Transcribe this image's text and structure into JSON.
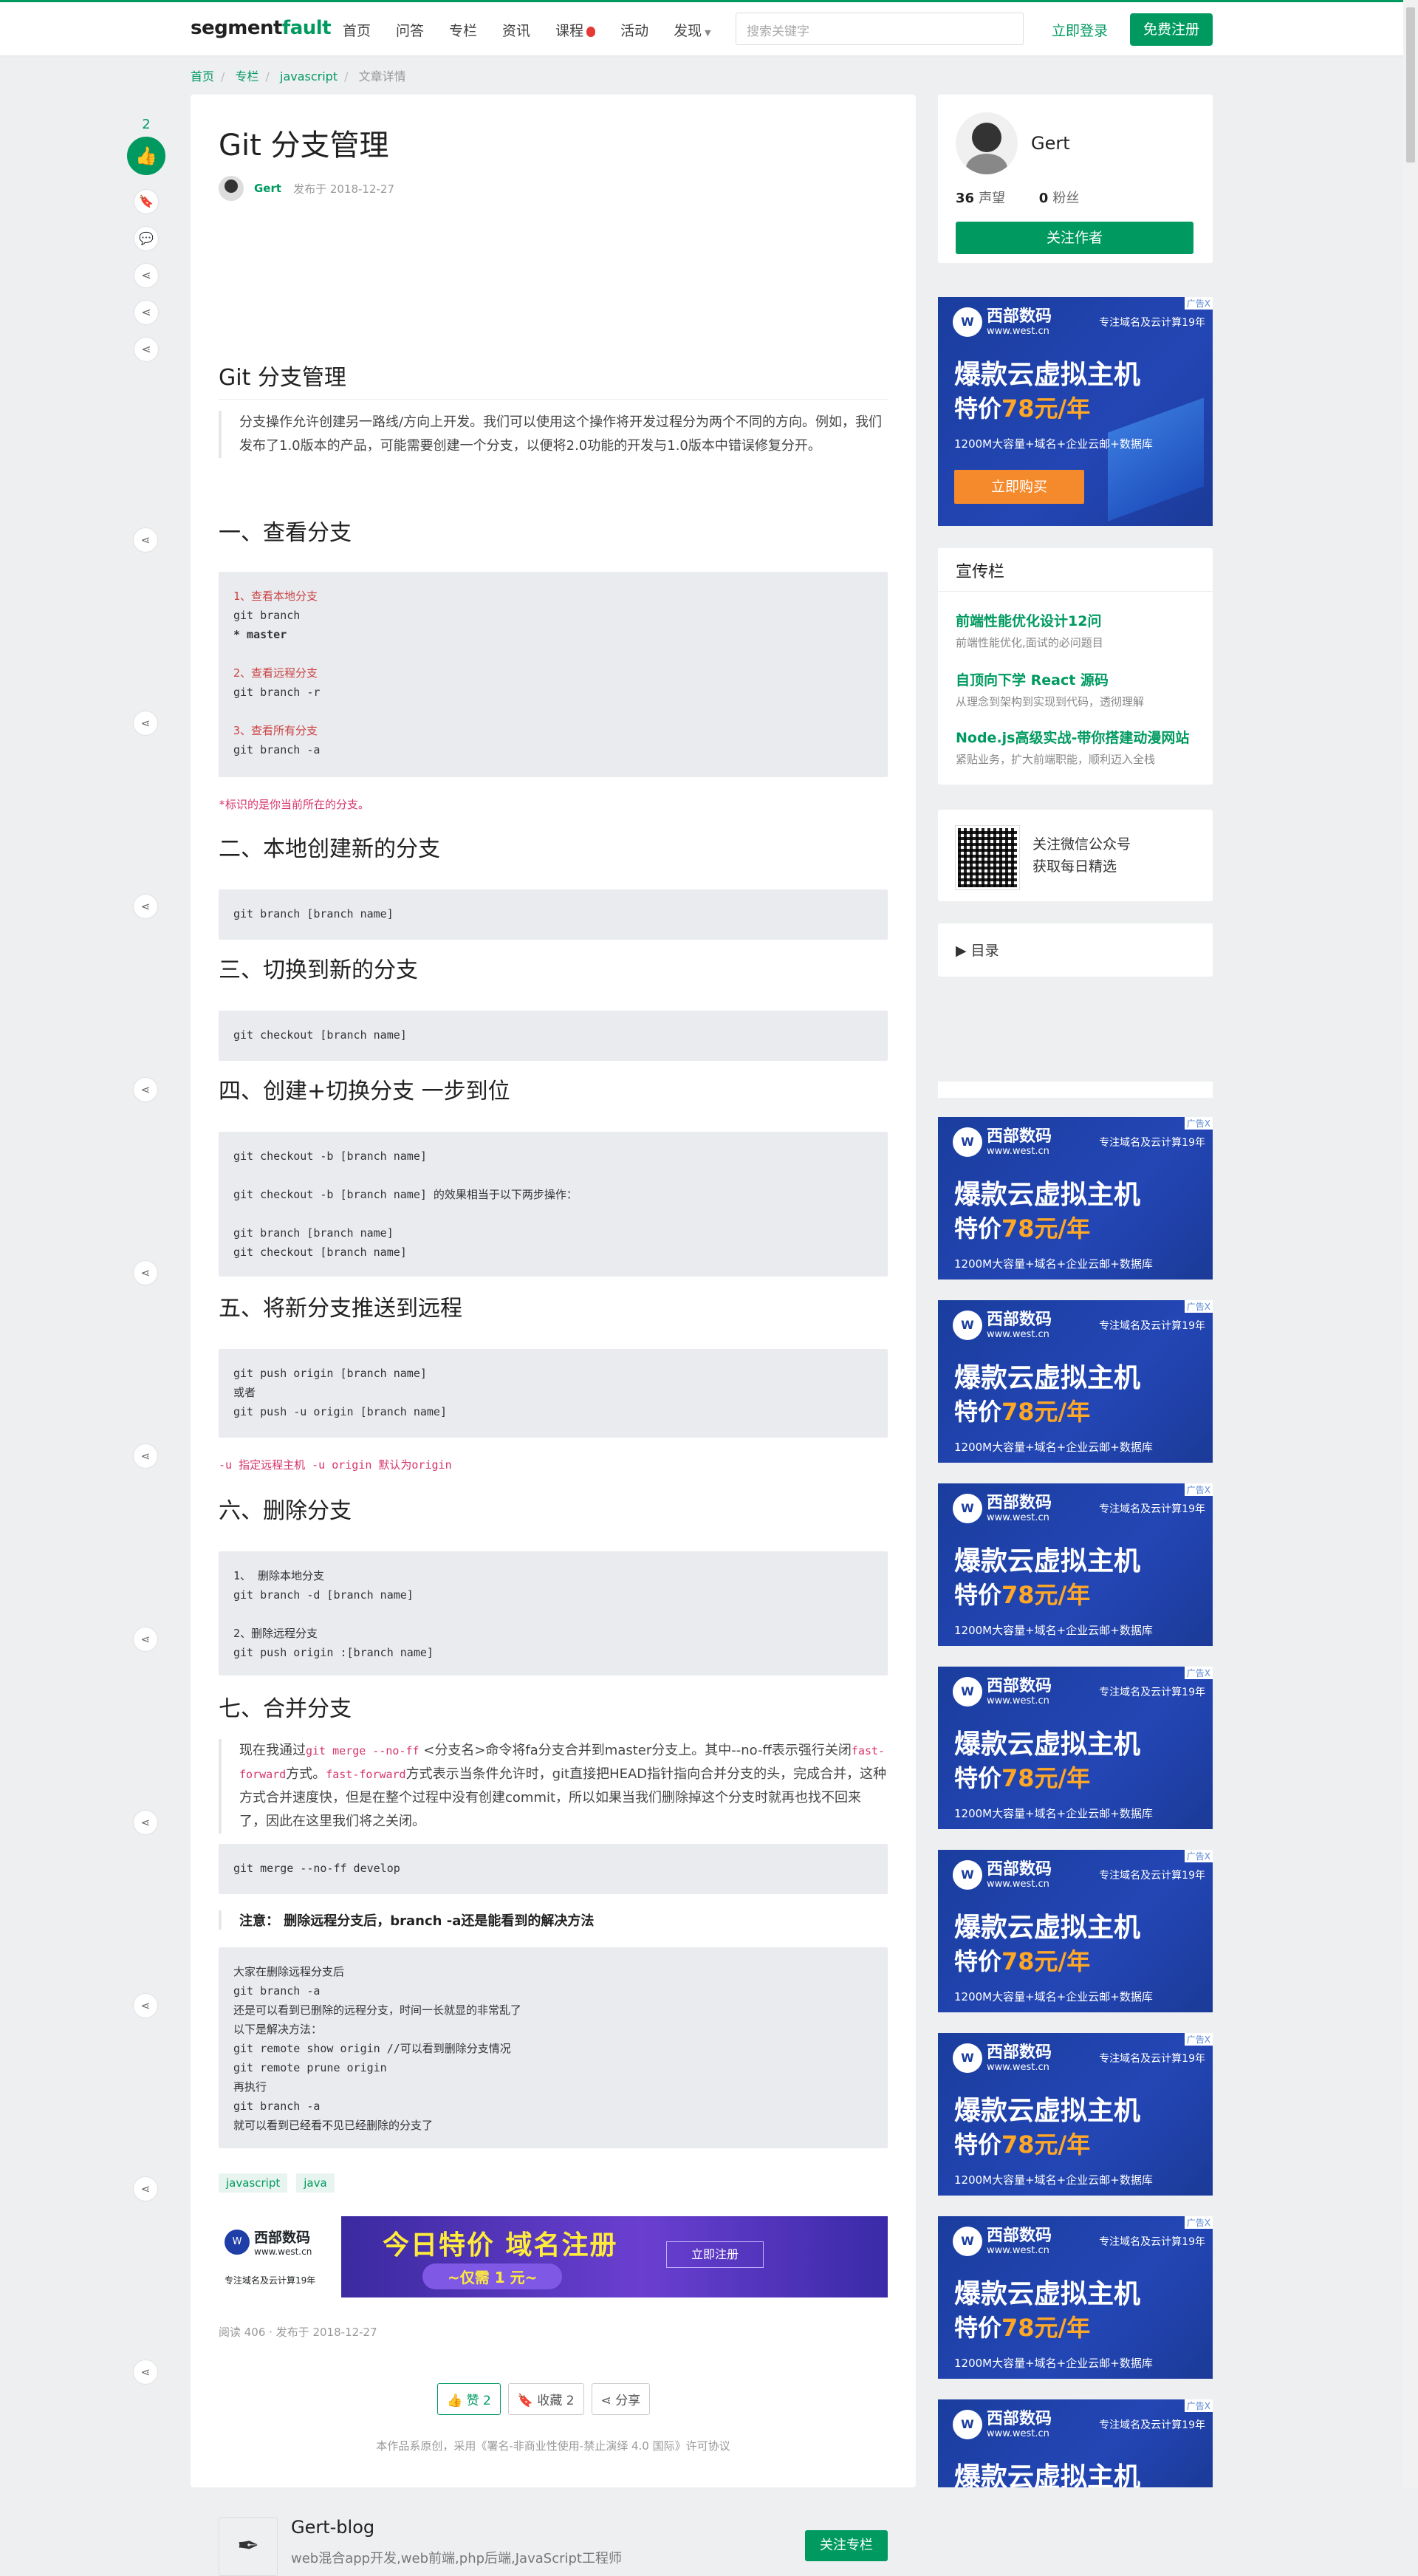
{
  "header": {
    "logo_a": "segment",
    "logo_b": "fault",
    "nav": [
      "首页",
      "问答",
      "专栏",
      "资讯",
      "课程",
      "活动",
      "发现"
    ],
    "search_placeholder": "搜索关键字",
    "login": "立即登录",
    "register": "免费注册"
  },
  "breadcrumb": [
    "首页",
    "专栏",
    "javascript",
    "文章详情"
  ],
  "side": {
    "like_count": "2"
  },
  "article": {
    "title": "Git 分支管理",
    "author": "Gert",
    "date": "发布于 2018-12-27",
    "h_main": "Git 分支管理",
    "intro": "分支操作允许创建另一路线/方向上开发。我们可以使用这个操作将开发过程分为两个不同的方向。例如，我们发布了1.0版本的产品，可能需要创建一个分支，以便将2.0功能的开发与1.0版本中错误修复分开。",
    "s1": "一、查看分支",
    "s1_code": [
      "1、查看本地分支",
      "git branch",
      "* master",
      "",
      "2、查看远程分支",
      "git branch -r",
      "",
      "3、查看所有分支",
      "git branch -a"
    ],
    "s1_note": "*标识的是你当前所在的分支。",
    "s2": "二、本地创建新的分支",
    "s2_code": "git branch [branch name]",
    "s3": "三、切换到新的分支",
    "s3_code": "git checkout [branch name]",
    "s4": "四、创建+切换分支 一步到位",
    "s4_code": [
      "git checkout -b [branch name]",
      "",
      "git checkout -b [branch name] 的效果相当于以下两步操作：",
      "",
      "git branch [branch name]",
      "git checkout [branch name]"
    ],
    "s5": "五、将新分支推送到远程",
    "s5_code": [
      "git push origin [branch name]",
      "或者",
      "git push -u origin [branch name]"
    ],
    "s5_note": "-u 指定远程主机 -u origin 默认为origin",
    "s6": "六、删除分支",
    "s6_code": [
      "1、 删除本地分支",
      "git branch -d [branch name]",
      "",
      "2、删除远程分支",
      "git push origin :[branch name]"
    ],
    "s7": "七、合并分支",
    "s7_text_a": "现在我通过",
    "s7_inl1": "git merge --no-ff",
    "s7_text_b": " <分支名>命令将fa分支合并到master分支上。其中--no-ff表示强行关闭",
    "s7_inl2": "fast-forward",
    "s7_text_c": "方式。",
    "s7_inl3": "fast-forward",
    "s7_text_d": "方式表示当条件允许时，git直接把HEAD指针指向合并分支的头，完成合并，这种方式合并速度快，但是在整个过程中没有创建commit，所以如果当我们删除掉这个分支时就再也找不回来了，因此在这里我们将之关闭。",
    "s7_code": "git merge --no-ff develop",
    "note": "注意： 删除远程分支后，branch -a还是能看到的解决方法",
    "last_code": [
      "大家在删除远程分支后",
      "git branch -a",
      "还是可以看到已删除的远程分支，时间一长就显的非常乱了",
      "以下是解决方法：",
      "git remote show origin //可以看到删除分支情况",
      "git remote prune origin",
      "再执行",
      "git branch -a",
      "就可以看到已经看不见已经删除的分支了"
    ],
    "tags": [
      "javascript",
      "java"
    ],
    "banner": {
      "brand": "西部数码",
      "brand_url": "www.west.cn",
      "brand_slogan": "专注域名及云计算19年",
      "big": "今日特价 域名注册",
      "pill": "~仅需 1 元~",
      "buy": "立即注册"
    },
    "readinfo": "阅读 406 · 发布于 2018-12-27",
    "btn_like": "赞 2",
    "btn_fav": "收藏 2",
    "btn_share": "分享",
    "license": "本作品系原创，采用《署名-非商业性使用-禁止演绎 4.0 国际》许可协议",
    "blog_name": "Gert-blog",
    "blog_desc": "web混合app开发,web前端,php后端,JavaScript工程师",
    "blog_follow": "关注专栏"
  },
  "author_card": {
    "name": "Gert",
    "reputation": "36",
    "reputation_label": "声望",
    "fans": "0",
    "fans_label": "粉丝",
    "follow": "关注作者"
  },
  "ad": {
    "brand": "西部数码",
    "url": "www.west.cn",
    "slogan": "专注域名及云计算19年",
    "headline": "爆款云虚拟主机",
    "price_label": "特价",
    "price": "78元/年",
    "sub": "1200M大容量+域名+企业云邮+数据库",
    "buy": "立即购买",
    "close": "广告X"
  },
  "promo": {
    "title": "宣传栏",
    "items": [
      {
        "title": "前端性能优化设计12问",
        "desc": "前端性能优化,面试的必问题目"
      },
      {
        "title": "自顶向下学 React 源码",
        "desc": "从理念到架构到实现到代码，透彻理解"
      },
      {
        "title": "Node.js高级实战-带你搭建动漫网站",
        "desc": "紧贴业务，扩大前端职能，顺利迈入全栈"
      }
    ]
  },
  "wechat": {
    "line1": "关注微信公众号",
    "line2": "获取每日精选"
  },
  "toc": "目录"
}
